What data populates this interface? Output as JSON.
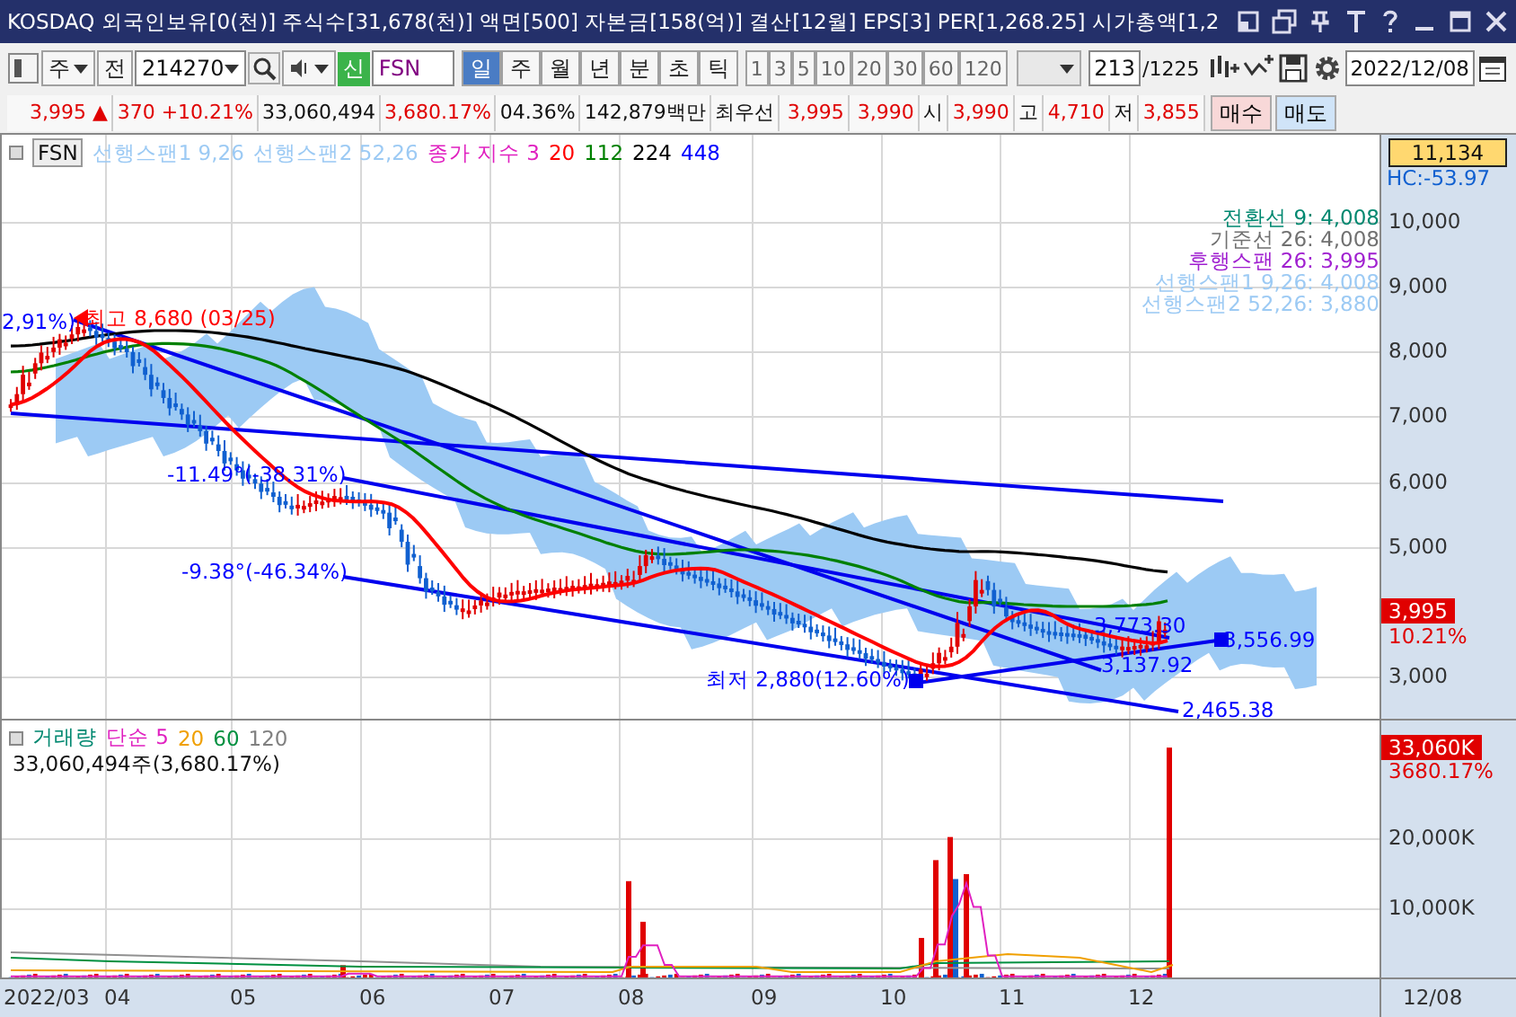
{
  "title_bar": {
    "text": "KOSDAQ 외국인보유[0(천)] 주식수[31,678(천)] 액면[500] 자본금[158(억)] 결산[12월] EPS[3] PER[1,268.25] 시가총액[1,2"
  },
  "toolbar": {
    "market": "주",
    "prev_label": "전",
    "code": "214270",
    "new_badge": "신",
    "name": "FSN",
    "periods": [
      {
        "label": "일",
        "selected": true
      },
      {
        "label": "주",
        "selected": false
      },
      {
        "label": "월",
        "selected": false
      },
      {
        "label": "년",
        "selected": false
      },
      {
        "label": "분",
        "selected": false
      },
      {
        "label": "초",
        "selected": false
      },
      {
        "label": "틱",
        "selected": false
      }
    ],
    "intervals": [
      {
        "label": "1",
        "selected": false
      },
      {
        "label": "3",
        "selected": false
      },
      {
        "label": "5",
        "selected": false
      },
      {
        "label": "10",
        "selected": false
      },
      {
        "label": "20",
        "selected": false
      },
      {
        "label": "30",
        "selected": false
      },
      {
        "label": "60",
        "selected": false
      },
      {
        "label": "120",
        "selected": false
      }
    ],
    "count": "213",
    "total": "/1225",
    "date": "2022/12/08"
  },
  "quote": {
    "price": "3,995 ▲",
    "change": "370 +10.21%",
    "volume": "33,060,494",
    "volume_ratio": "3,680.17%",
    "turnover": "04.36%",
    "amount": "142,879백만",
    "best_label": "최우선",
    "ask": "3,995",
    "bid": "3,990",
    "fields": [
      {
        "label": "시",
        "value": "3,990"
      },
      {
        "label": "고",
        "value": "4,710"
      },
      {
        "label": "저",
        "value": "3,855"
      }
    ],
    "buy": "매수",
    "sell": "매도"
  },
  "price_pane": {
    "symbol": "FSN",
    "legend": [
      {
        "text": "선행스팬1 9,26",
        "color": "#9ccaf4"
      },
      {
        "text": "선행스팬2 52,26",
        "color": "#9ccaf4"
      },
      {
        "text": "종가 지수 3",
        "color": "#e020c0"
      },
      {
        "text": "20",
        "color": "#ff0000"
      },
      {
        "text": "112",
        "color": "#008000"
      },
      {
        "text": "224",
        "color": "#000000"
      },
      {
        "text": "448",
        "color": "#0000ff"
      }
    ],
    "indicators": [
      {
        "text": "전환선 9: 4,008",
        "color": "#008870"
      },
      {
        "text": "기준선 26: 4,008",
        "color": "#707070"
      },
      {
        "text": "후행스팬 26: 3,995",
        "color": "#a020d0"
      },
      {
        "text": "선행스팬1 9,26: 4,008",
        "color": "#9ccaf4"
      },
      {
        "text": "선행스팬2 52,26: 3,880",
        "color": "#9ccaf4"
      }
    ],
    "annotations": [
      {
        "text": "2,91%)",
        "color": "#0000ff"
      },
      {
        "text": "최고 8,680 (03/25)",
        "color": "#ff0000"
      },
      {
        "text": "-11.49°(-38.31%)",
        "color": "#0000ff"
      },
      {
        "text": "-9.38°(-46.34%)",
        "color": "#0000ff"
      },
      {
        "text": "최저 2,880(12.60%)",
        "color": "#0000ff"
      },
      {
        "text": "3,773.30",
        "color": "#0000ff"
      },
      {
        "text": "3,137.92",
        "color": "#0000ff"
      },
      {
        "text": "3,556.99",
        "color": "#0000ff"
      },
      {
        "text": "2,465.38",
        "color": "#0000ff"
      }
    ],
    "axis": {
      "high_box": "11,134",
      "hc": "HC:-53.97",
      "ticks": [
        "10,000",
        "9,000",
        "8,000",
        "7,000",
        "6,000",
        "5,000",
        "3,000"
      ],
      "current_box": "3,995",
      "change": "10.21%"
    }
  },
  "volume_pane": {
    "legend": [
      {
        "text": "거래량",
        "color": "#008870"
      },
      {
        "text": "단순 5",
        "color": "#e020c0"
      },
      {
        "text": "20",
        "color": "#f0a000"
      },
      {
        "text": "60",
        "color": "#009040"
      },
      {
        "text": "120",
        "color": "#808080"
      }
    ],
    "summary": "33,060,494주(3,680.17%)",
    "axis": {
      "current_box": "33,060K",
      "ratio": "3680.17%",
      "ticks": [
        "20,000K",
        "10,000K"
      ]
    }
  },
  "x_axis": {
    "labels": [
      "2022/03",
      "04",
      "05",
      "06",
      "07",
      "08",
      "09",
      "10",
      "11",
      "12"
    ],
    "end": "12/08"
  }
}
